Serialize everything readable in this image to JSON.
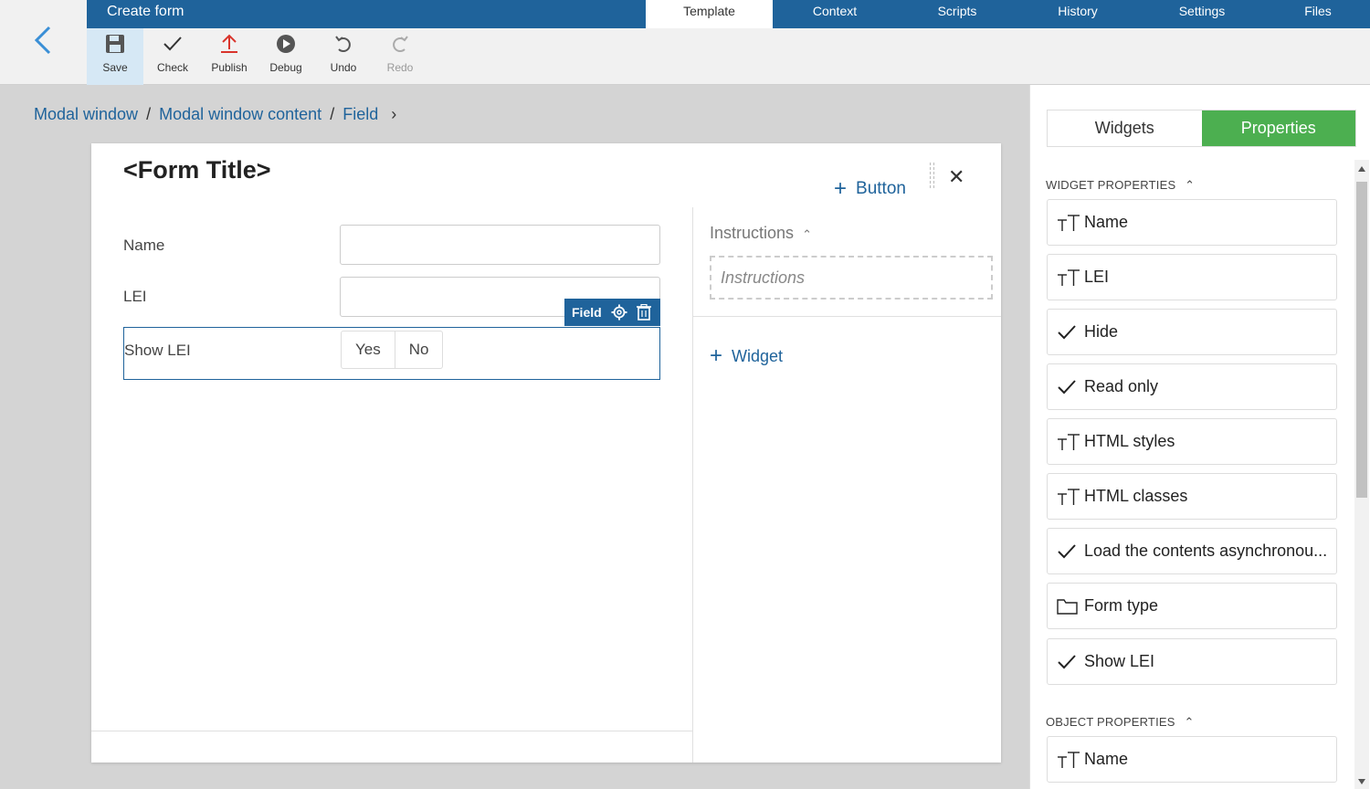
{
  "app": {
    "title": "Create form"
  },
  "tabs": [
    {
      "label": "Template",
      "active": true
    },
    {
      "label": "Context",
      "active": false
    },
    {
      "label": "Scripts",
      "active": false
    },
    {
      "label": "History",
      "active": false
    },
    {
      "label": "Settings",
      "active": false
    },
    {
      "label": "Files",
      "active": false
    }
  ],
  "toolbar": {
    "save": "Save",
    "check": "Check",
    "publish": "Publish",
    "debug": "Debug",
    "undo": "Undo",
    "redo": "Redo"
  },
  "breadcrumb": [
    "Modal window",
    "Modal window content",
    "Field"
  ],
  "form": {
    "title": "<Form Title>",
    "add_button": "Button",
    "fields": [
      {
        "label": "Name"
      },
      {
        "label": "LEI"
      }
    ],
    "selected_field": {
      "label": "Show LEI",
      "tag": "Field",
      "options": [
        "Yes",
        "No"
      ]
    },
    "instructions_header": "Instructions",
    "instructions_placeholder": "Instructions",
    "add_widget": "Widget"
  },
  "right_panel": {
    "tabs": [
      {
        "label": "Widgets",
        "active": false
      },
      {
        "label": "Properties",
        "active": true
      }
    ],
    "widget_properties_header": "WIDGET PROPERTIES",
    "widget_properties": [
      {
        "icon": "text-type-icon",
        "label": "Name"
      },
      {
        "icon": "text-type-icon",
        "label": "LEI"
      },
      {
        "icon": "check-icon",
        "label": "Hide"
      },
      {
        "icon": "check-icon",
        "label": "Read only"
      },
      {
        "icon": "text-type-icon",
        "label": "HTML styles"
      },
      {
        "icon": "text-type-icon",
        "label": "HTML classes"
      },
      {
        "icon": "check-icon",
        "label": "Load the contents asynchronou..."
      },
      {
        "icon": "folder-icon",
        "label": "Form type"
      },
      {
        "icon": "check-icon",
        "label": "Show LEI"
      }
    ],
    "object_properties_header": "OBJECT PROPERTIES",
    "object_properties": [
      {
        "icon": "text-type-icon",
        "label": "Name"
      }
    ]
  },
  "colors": {
    "primary": "#1f639b",
    "accent_green": "#4caf50",
    "canvas_bg": "#d4d4d4"
  }
}
